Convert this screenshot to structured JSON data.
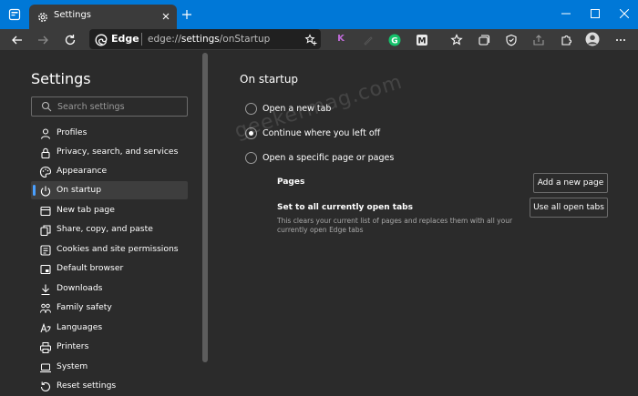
{
  "window": {
    "tab_title": "Settings",
    "icons": [
      "tab-actions-icon",
      "gear-icon",
      "close-icon",
      "plus-icon",
      "minimize-icon",
      "maximize-icon",
      "window-close-icon"
    ]
  },
  "toolbar": {
    "brand": "Edge",
    "url_prefix": "edge://",
    "url_host": "settings",
    "url_path": "/onStartup",
    "extensions": [
      {
        "letter": "K",
        "color": "#c06ad8"
      },
      {
        "letter": "G",
        "color": "#15c26b"
      },
      {
        "letter": "M",
        "color": "#9a9a9a"
      }
    ]
  },
  "sidebar": {
    "title": "Settings",
    "search_placeholder": "Search settings",
    "items": [
      {
        "label": "Profiles",
        "icon": "profile-icon",
        "active": false
      },
      {
        "label": "Privacy, search, and services",
        "icon": "lock-icon",
        "active": false
      },
      {
        "label": "Appearance",
        "icon": "appearance-icon",
        "active": false
      },
      {
        "label": "On startup",
        "icon": "power-icon",
        "active": true
      },
      {
        "label": "New tab page",
        "icon": "new-tab-icon",
        "active": false
      },
      {
        "label": "Share, copy, and paste",
        "icon": "share-icon",
        "active": false
      },
      {
        "label": "Cookies and site permissions",
        "icon": "cookies-icon",
        "active": false
      },
      {
        "label": "Default browser",
        "icon": "browser-icon",
        "active": false
      },
      {
        "label": "Downloads",
        "icon": "download-icon",
        "active": false
      },
      {
        "label": "Family safety",
        "icon": "family-icon",
        "active": false
      },
      {
        "label": "Languages",
        "icon": "languages-icon",
        "active": false
      },
      {
        "label": "Printers",
        "icon": "printer-icon",
        "active": false
      },
      {
        "label": "System",
        "icon": "system-icon",
        "active": false
      },
      {
        "label": "Reset settings",
        "icon": "reset-icon",
        "active": false
      }
    ]
  },
  "main": {
    "title": "On startup",
    "options": [
      {
        "label": "Open a new tab",
        "checked": false
      },
      {
        "label": "Continue where you left off",
        "checked": true
      },
      {
        "label": "Open a specific page or pages",
        "checked": false
      }
    ],
    "pages_label": "Pages",
    "add_page_button": "Add a new page",
    "set_tabs_label": "Set to all currently open tabs",
    "set_tabs_desc": "This clears your current list of pages and replaces them with all your currently open Edge tabs",
    "use_tabs_button": "Use all open tabs",
    "watermark": "geekermag.com"
  },
  "colors": {
    "titlebar": "#0078d7",
    "accent": "#4aa0ff",
    "background": "#2b2b2b"
  }
}
